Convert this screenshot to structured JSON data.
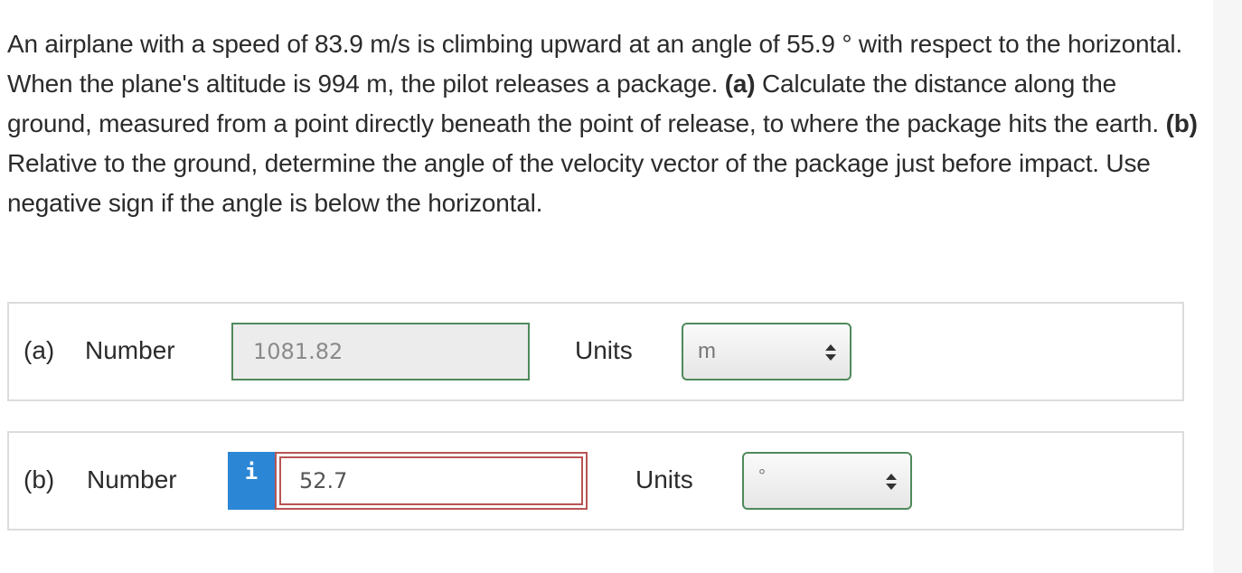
{
  "question": {
    "p1": "An airplane with a speed of 83.9 m/s is climbing upward at an angle of 55.9 ° with respect to the horizontal. When the plane's altitude is 994 m, the pilot releases a package. ",
    "part_a_tag": "(a)",
    "p2": " Calculate the distance along the ground, measured from a point directly beneath the point of release, to where the package hits the earth. ",
    "part_b_tag": "(b)",
    "p3": " Relative to the ground, determine the angle of the velocity vector of the package just before impact. Use negative sign if the angle is below the horizontal."
  },
  "part_a": {
    "label": "(a)",
    "number_label": "Number",
    "value": "1081.82",
    "units_label": "Units",
    "unit_selected": "m"
  },
  "part_b": {
    "label": "(b)",
    "number_label": "Number",
    "info_icon_glyph": "i",
    "value": "52.7",
    "units_label": "Units",
    "unit_selected": "°"
  },
  "colors": {
    "correct_border": "#4f8a5b",
    "incorrect_border": "#b85454",
    "info_button": "#2c86d6"
  }
}
